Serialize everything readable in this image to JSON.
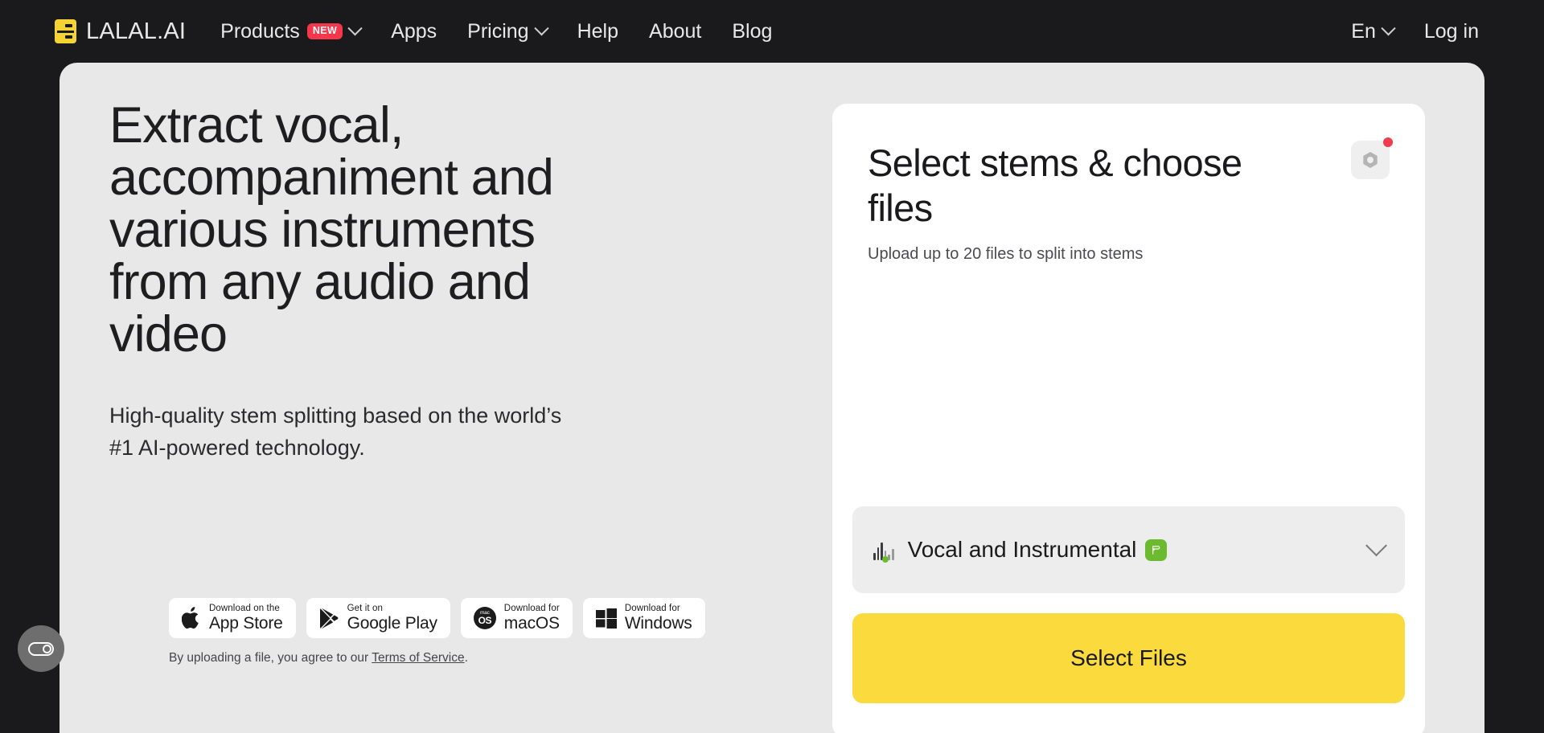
{
  "header": {
    "brand_name": "LALAL.AI",
    "logo_icon": "lalal-logo-icon",
    "nav": [
      {
        "label": "Products",
        "badge": "NEW",
        "has_chevron": true
      },
      {
        "label": "Apps",
        "badge": null,
        "has_chevron": false
      },
      {
        "label": "Pricing",
        "badge": null,
        "has_chevron": true
      },
      {
        "label": "Help",
        "badge": null,
        "has_chevron": false
      },
      {
        "label": "About",
        "badge": null,
        "has_chevron": false
      },
      {
        "label": "Blog",
        "badge": null,
        "has_chevron": false
      }
    ],
    "language": "En",
    "login": "Log in"
  },
  "hero": {
    "headline": "Extract vocal, accompaniment and various instruments from any audio and video",
    "subhead": "High-quality stem splitting based on the world’s #1 AI-powered technology.",
    "downloads": [
      {
        "small": "Download on the",
        "big": "App Store",
        "icon": "apple-icon"
      },
      {
        "small": "Get it on",
        "big": "Google Play",
        "icon": "google-play-icon"
      },
      {
        "small": "Download for",
        "big": "macOS",
        "icon": "macos-icon"
      },
      {
        "small": "Download for",
        "big": "Windows",
        "icon": "windows-icon"
      }
    ],
    "tos_prefix": "By uploading a file, you agree to our ",
    "tos_link": "Terms of Service",
    "tos_suffix": "."
  },
  "cookie_widget": {
    "icon": "cookie-consent-icon"
  },
  "card": {
    "title": "Select stems & choose files",
    "subtitle": "Upload up to 20 files to split into stems",
    "settings_icon": "gear-nut-icon",
    "has_notification_dot": true,
    "stem_select": {
      "icon": "waveform-icon",
      "label": "Vocal and Instrumental",
      "model_badge": "phoenix-model-icon",
      "chevron": "chevron-down-icon"
    },
    "select_files_label": "Select Files"
  },
  "colors": {
    "page_dark": "#1a1a1c",
    "stage_grey": "#e8e8e8",
    "card_white": "#ffffff",
    "brand_yellow": "#fada3d",
    "logo_yellow": "#f5d335",
    "badge_red": "#f4374a",
    "notif_red": "#ef3b4e",
    "model_green": "#6cba2e"
  }
}
